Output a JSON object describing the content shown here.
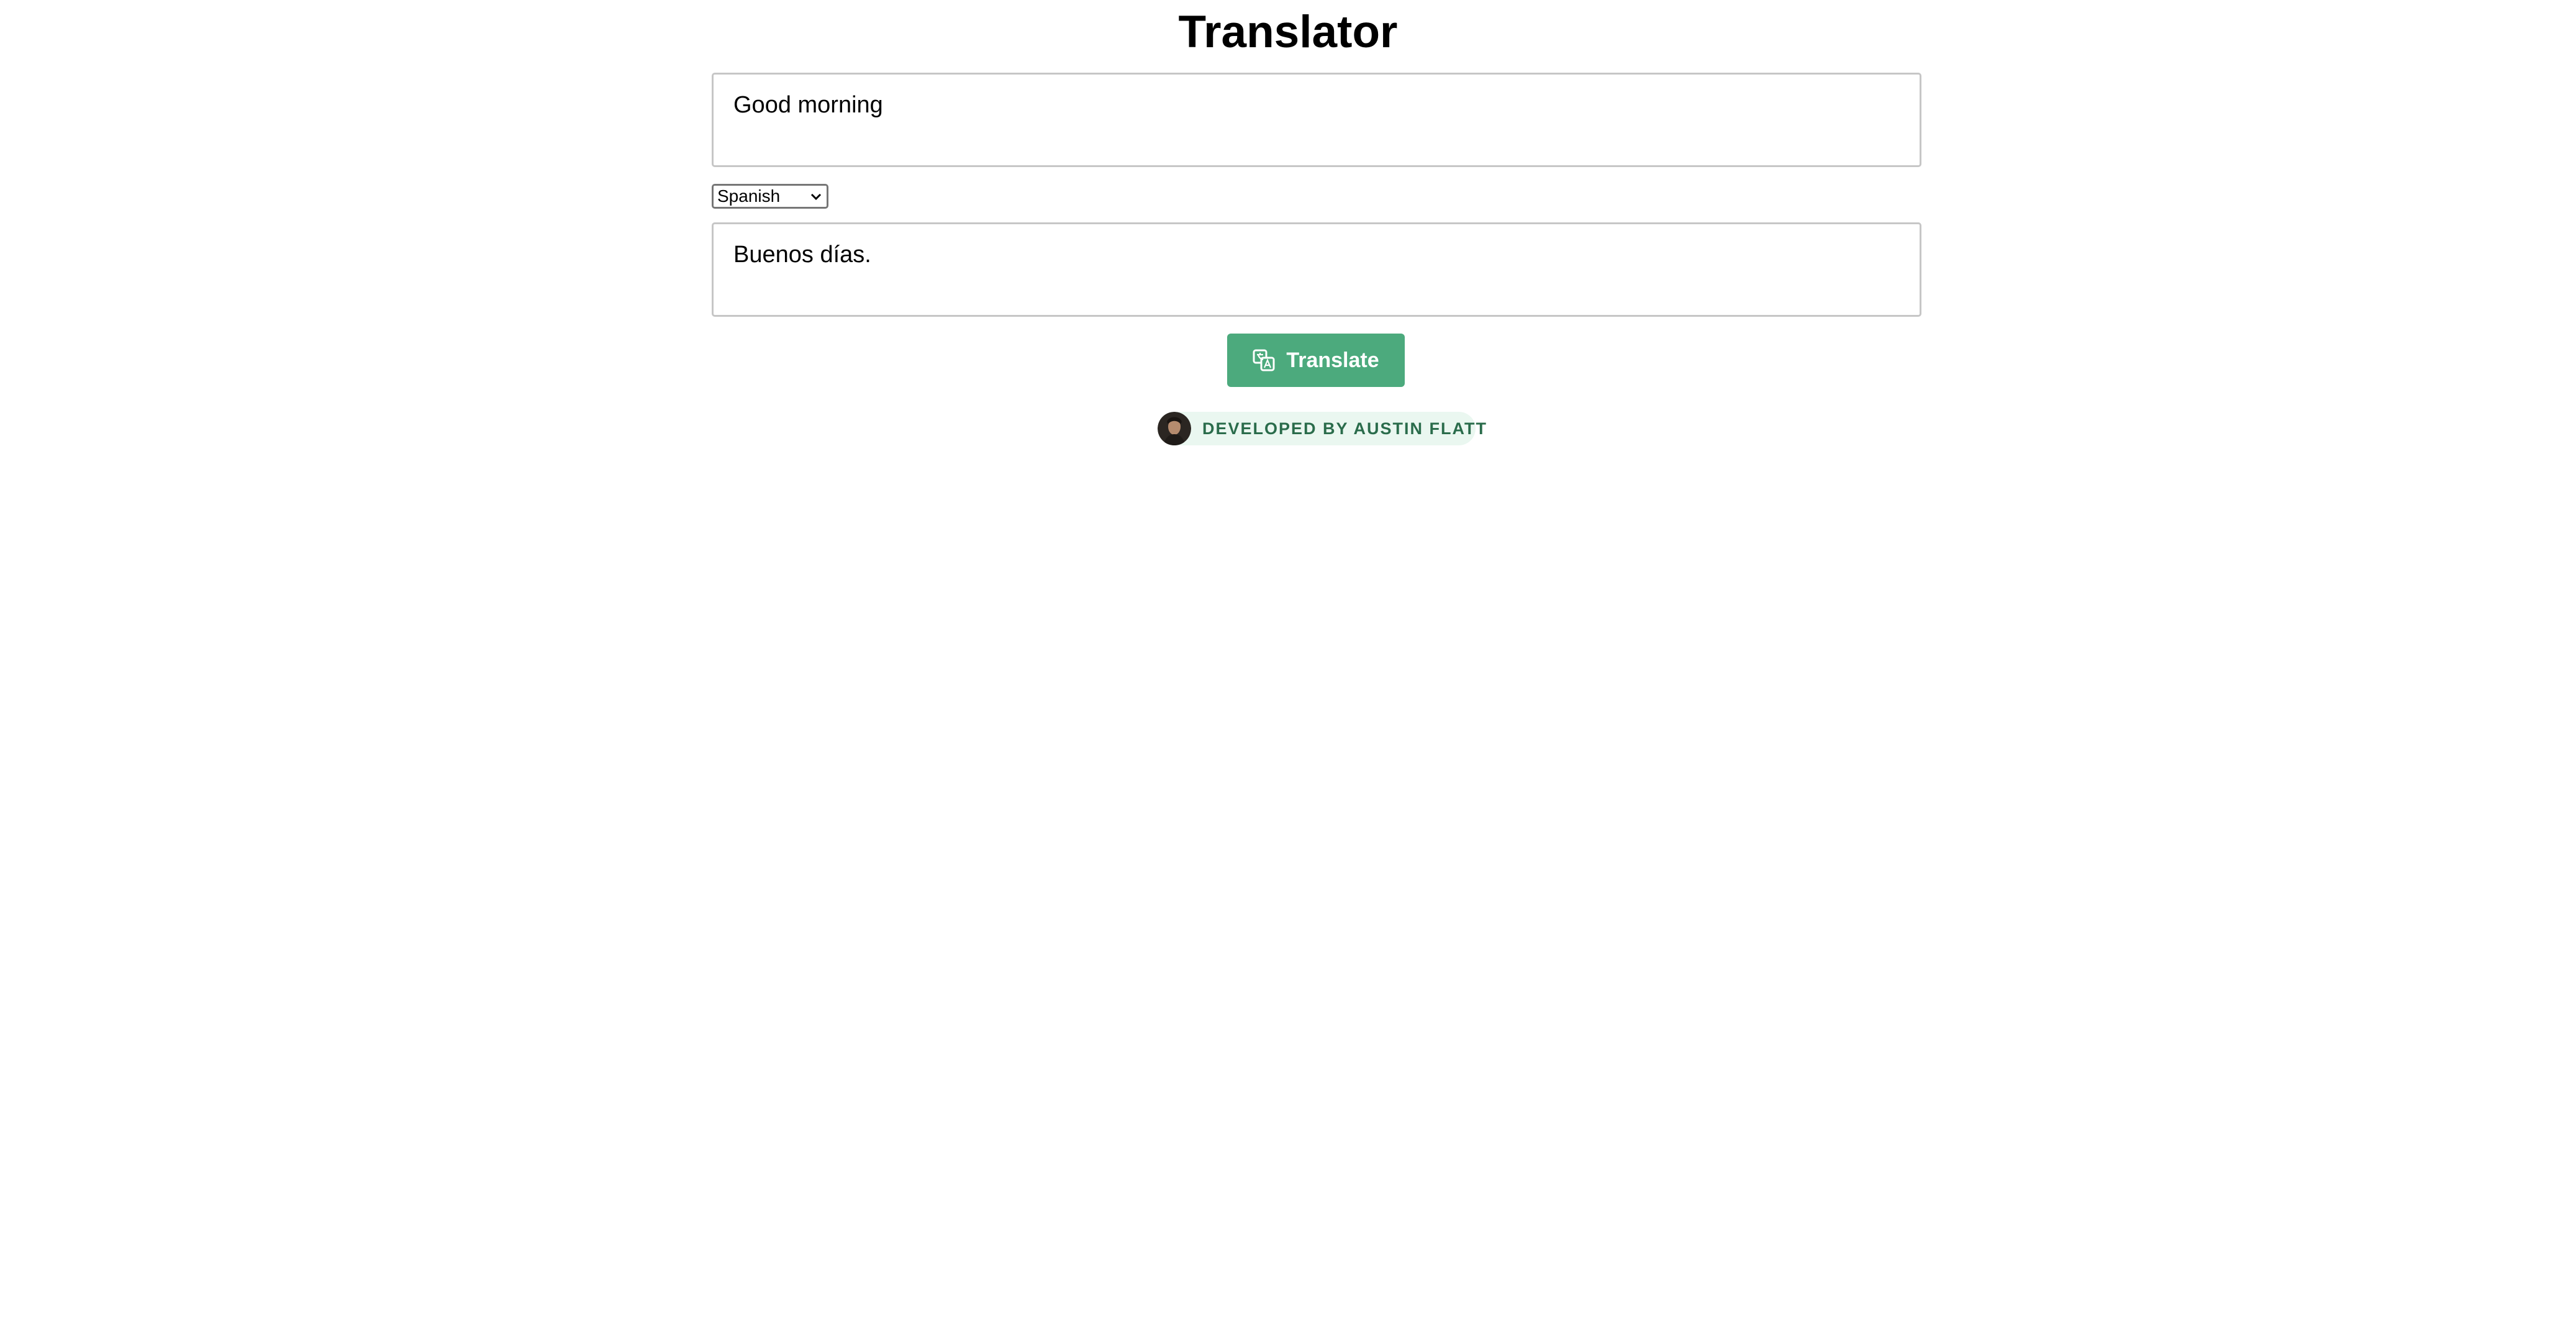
{
  "page": {
    "title": "Translator"
  },
  "source": {
    "value": "Good morning"
  },
  "language_select": {
    "selected": "Spanish"
  },
  "output": {
    "value": "Buenos días."
  },
  "translate_button": {
    "label": "Translate",
    "icon": "translate-icon",
    "color": "#4caa7d"
  },
  "credit": {
    "text": "DEVELOPED BY AUSTIN FLATT",
    "avatar_icon": "avatar",
    "background": "#eaf7f0",
    "text_color": "#2a6c4b"
  }
}
